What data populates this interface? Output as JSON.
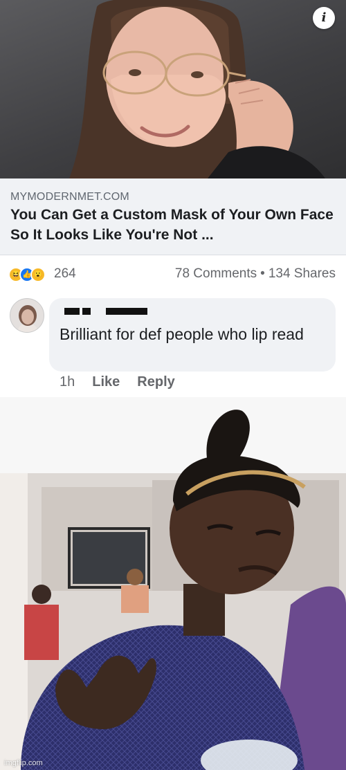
{
  "hero": {
    "info_glyph": "i"
  },
  "link": {
    "domain": "MYMODERNMET.COM",
    "title": "You Can Get a Custom Mask of Your Own Face So It Looks Like You're Not ..."
  },
  "reactions": {
    "icons": [
      "haha-icon",
      "like-icon",
      "wow-icon"
    ],
    "count": "264",
    "comments": "78 Comments",
    "separator": "•",
    "shares": "134 Shares"
  },
  "comment": {
    "text": "Brilliant for def people who lip read",
    "time": "1h",
    "like_label": "Like",
    "reply_label": "Reply"
  },
  "meme": {
    "watermark": "imgflip.com"
  },
  "colors": {
    "link_bg": "#f0f2f5",
    "like_blue": "#1877f2",
    "reaction_yellow": "#f7b928",
    "meta_gray": "#65676b"
  }
}
